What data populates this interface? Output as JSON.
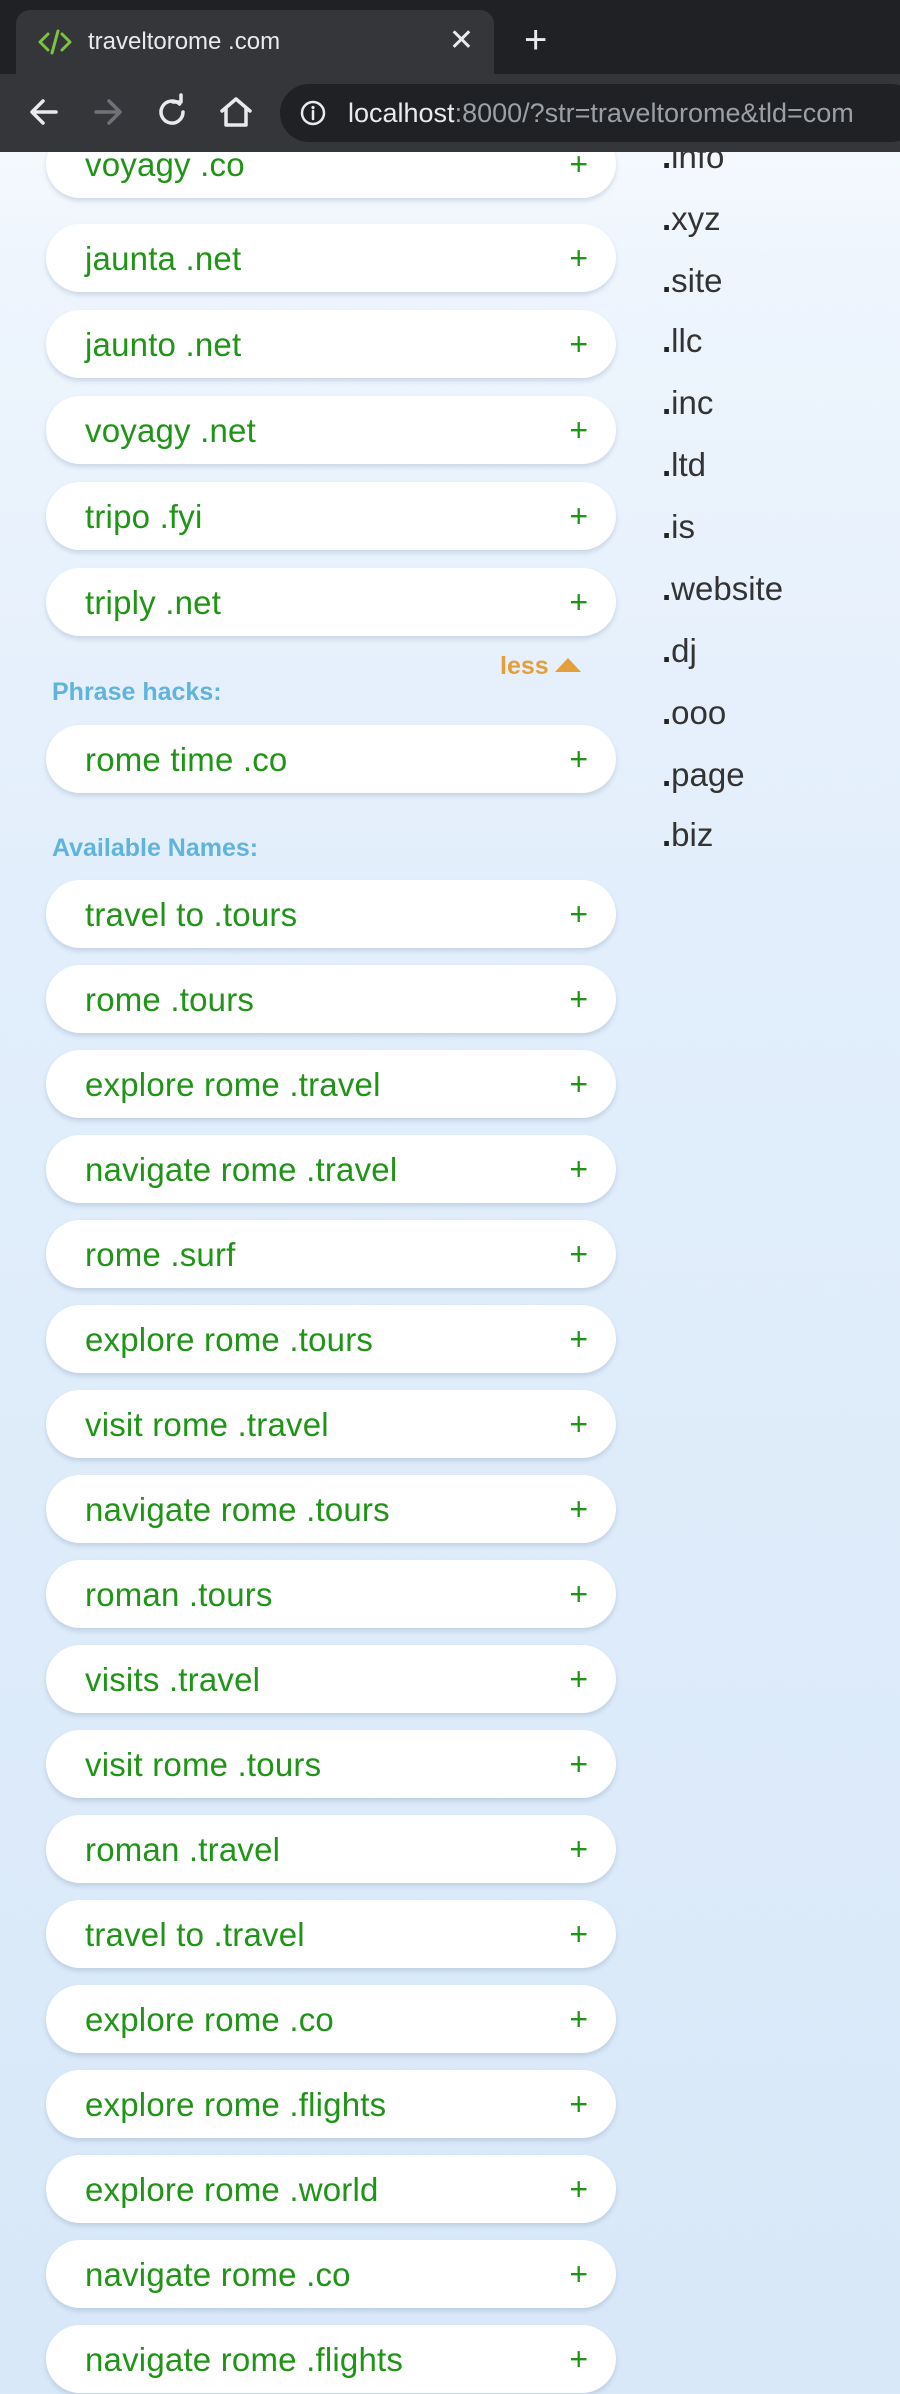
{
  "browser": {
    "tab_title": "traveltorome .com",
    "close_glyph": "✕",
    "new_tab_glyph": "+",
    "url_host": "localhost",
    "url_rest": ":8000/?str=traveltorome&tld=com"
  },
  "suggestions": {
    "items": [
      {
        "name": "voyagy .co"
      },
      {
        "name": "jaunta .net"
      },
      {
        "name": "jaunto .net"
      },
      {
        "name": "voyagy .net"
      },
      {
        "name": "tripo .fyi"
      },
      {
        "name": "triply .net"
      }
    ],
    "less_label": "less"
  },
  "phrase_hacks": {
    "label": "Phrase hacks:",
    "items": [
      {
        "name": "rome time .co"
      }
    ]
  },
  "available_names": {
    "label": "Available Names:",
    "items": [
      {
        "name": "travel to .tours"
      },
      {
        "name": "rome .tours"
      },
      {
        "name": "explore rome .travel"
      },
      {
        "name": "navigate rome .travel"
      },
      {
        "name": "rome .surf"
      },
      {
        "name": "explore rome .tours"
      },
      {
        "name": "visit rome .travel"
      },
      {
        "name": "navigate rome .tours"
      },
      {
        "name": "roman .tours"
      },
      {
        "name": "visits .travel"
      },
      {
        "name": "visit rome .tours"
      },
      {
        "name": "roman .travel"
      },
      {
        "name": "travel to .travel"
      },
      {
        "name": "explore rome .co"
      },
      {
        "name": "explore rome .flights"
      },
      {
        "name": "explore rome .world"
      },
      {
        "name": "navigate rome .co"
      },
      {
        "name": "navigate rome .flights"
      }
    ]
  },
  "plus_glyph": "+",
  "tlds": [
    "info",
    "xyz",
    "site",
    "llc",
    "inc",
    "ltd",
    "is",
    "website",
    "dj",
    "ooo",
    "page",
    "biz"
  ],
  "colors": {
    "domain_green": "#1f9416",
    "section_blue": "#5fb3dc",
    "less_orange": "#e3a03a"
  }
}
